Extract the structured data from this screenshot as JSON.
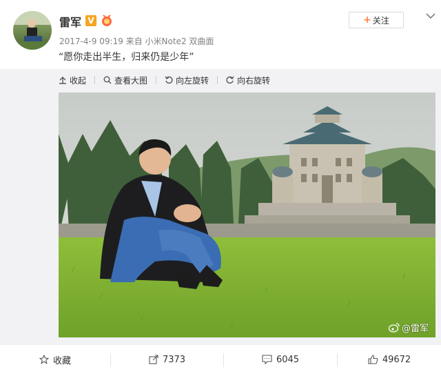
{
  "post": {
    "author": "雷军",
    "verified_badge": "V",
    "timestamp": "2017-4-9 09:19",
    "source_prefix": "来自",
    "source_device": "小米Note2 双曲面",
    "text": "“愿你走出半生，归来仍是少年”",
    "follow_label": "关注"
  },
  "toolbar": {
    "collapse": "收起",
    "view_large": "查看大图",
    "rotate_left": "向左旋转",
    "rotate_right": "向右旋转"
  },
  "image": {
    "watermark": "@雷军"
  },
  "actions": {
    "favorite": "收藏",
    "repost": "7373",
    "comment": "6045",
    "like": "49672"
  },
  "colors": {
    "accent": "#ff8140",
    "badge": "#f5a623",
    "text": "#333333",
    "muted": "#808080"
  }
}
